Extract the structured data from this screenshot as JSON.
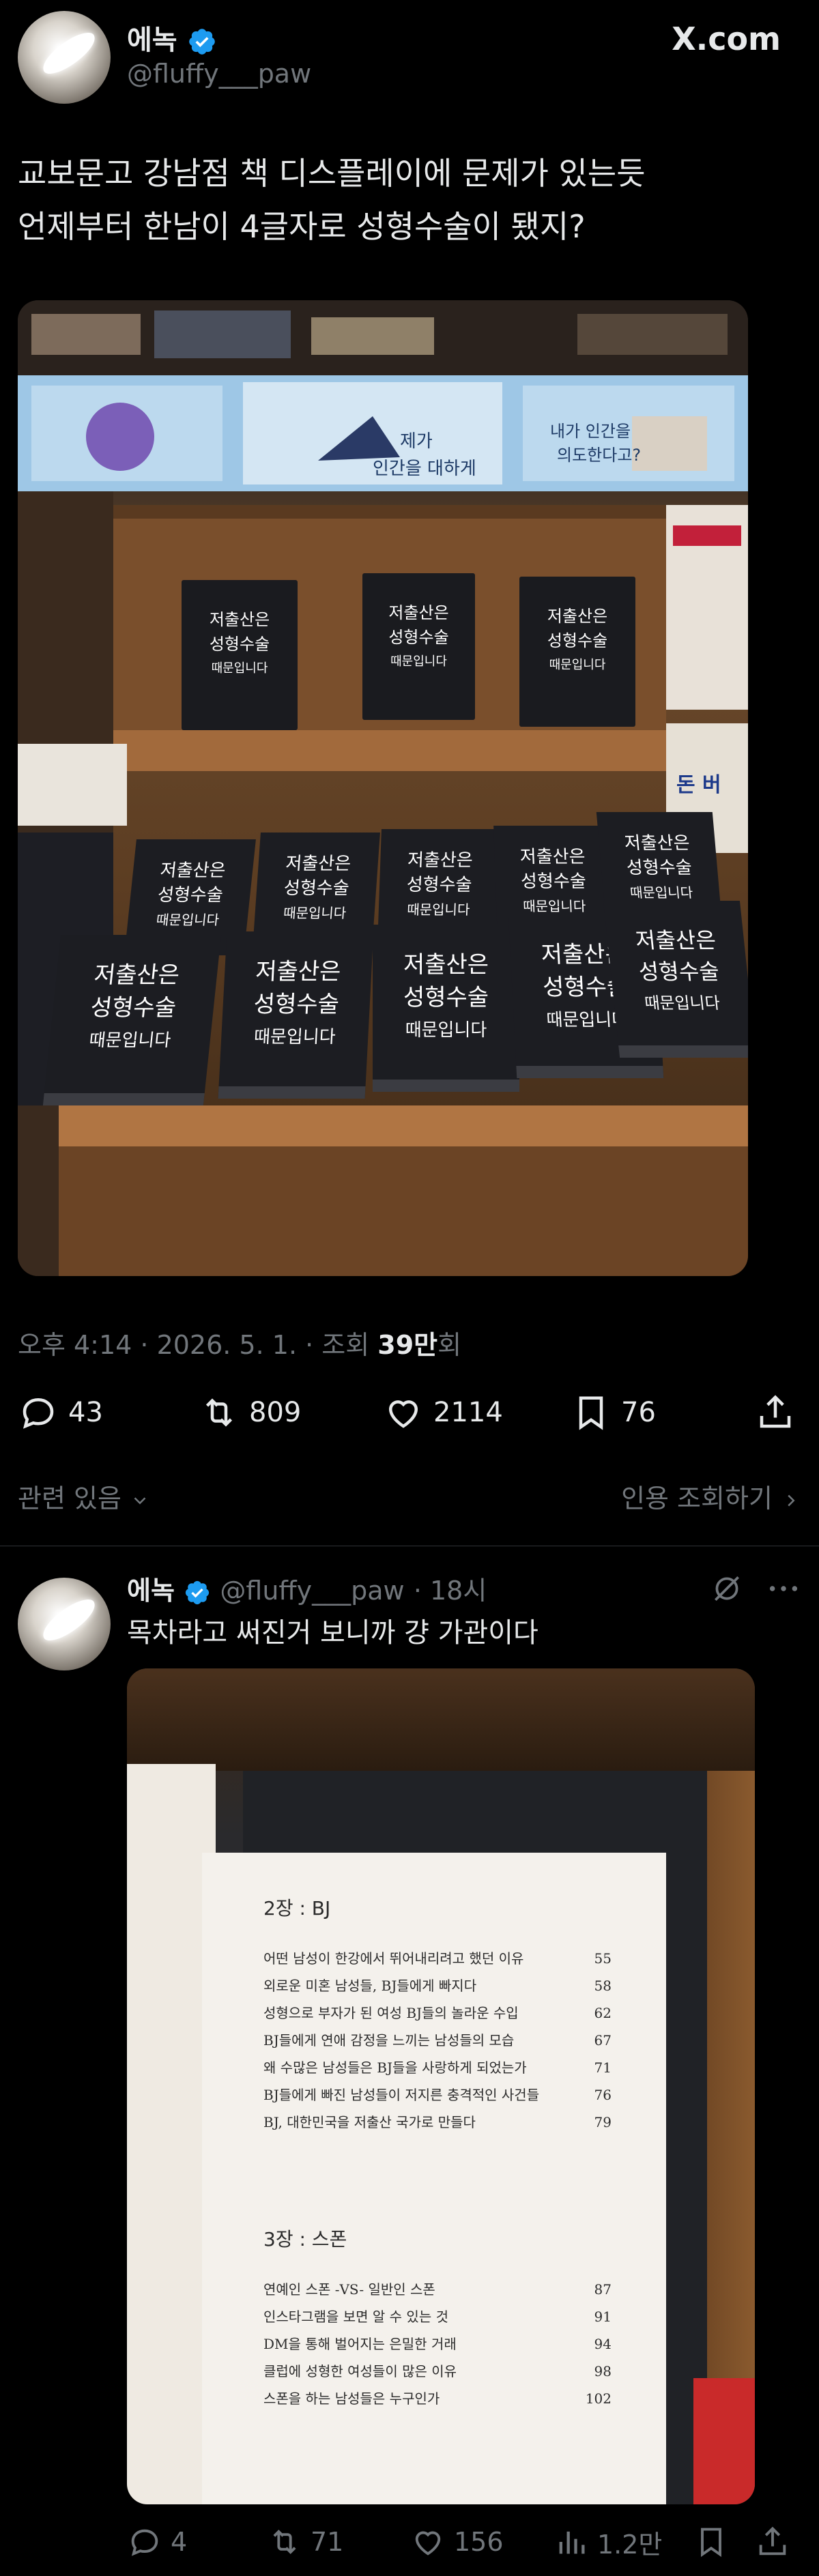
{
  "header": {
    "display_name": "에녹",
    "handle": "@fluffy___paw",
    "site_logo": "X.com"
  },
  "tweet": {
    "text_line1": "교보문고 강남점 책 디스플레이에 문제가 있는듯",
    "text_line2": "언제부터 한남이 4글자로 성형수술이 됐지?",
    "time_prefix": "오후 4:14 · 2026. 5. 1. · 조회 ",
    "views": "39만",
    "views_suffix": "회",
    "replies": "43",
    "retweets": "809",
    "likes": "2114",
    "bookmarks": "76",
    "related_label": "관련 있음",
    "quotes_label": "인용 조회하기"
  },
  "book": {
    "title_line1": "저출산은",
    "title_line2": "성형수술",
    "title_line3": "때문입니다"
  },
  "toc": {
    "chapter2": "2장 : BJ",
    "chapter2_items": [
      {
        "title": "어떤 남성이 한강에서 뛰어내리려고 했던 이유",
        "page": "55"
      },
      {
        "title": "외로운 미혼 남성들, BJ들에게 빠지다",
        "page": "58"
      },
      {
        "title": "성형으로 부자가 된 여성 BJ들의 놀라운 수입",
        "page": "62"
      },
      {
        "title": "BJ들에게 연애 감정을 느끼는 남성들의 모습",
        "page": "67"
      },
      {
        "title": "왜 수많은 남성들은 BJ들을 사랑하게 되었는가",
        "page": "71"
      },
      {
        "title": "BJ들에게 빠진 남성들이 저지른 충격적인 사건들",
        "page": "76"
      },
      {
        "title": "BJ, 대한민국을 저출산 국가로 만들다",
        "page": "79"
      }
    ],
    "chapter3": "3장 : 스폰",
    "chapter3_items": [
      {
        "title": "연예인 스폰 -VS- 일반인 스폰",
        "page": "87"
      },
      {
        "title": "인스타그램을 보면 알 수 있는 것",
        "page": "91"
      },
      {
        "title": "DM을 통해 벌어지는 은밀한 거래",
        "page": "94"
      },
      {
        "title": "클럽에 성형한 여성들이 많은 이유",
        "page": "98"
      },
      {
        "title": "스폰을 하는 남성들은 누구인가",
        "page": "102"
      }
    ]
  },
  "reply": {
    "display_name": "에녹",
    "handle": "@fluffy___paw",
    "time": "· 18시",
    "text": "목차라고 써진거 보니까 걍 가관이다",
    "replies": "4",
    "retweets": "71",
    "likes": "156",
    "views": "1.2만"
  },
  "icons": [
    "verified-badge-icon",
    "reply-icon",
    "retweet-icon",
    "like-icon",
    "bookmark-icon",
    "share-icon",
    "chevron-down-icon",
    "chevron-right-icon",
    "grok-icon",
    "more-icon",
    "views-icon"
  ],
  "colors": {
    "background": "#000000",
    "text": "#e7e9ea",
    "secondary": "#71767b",
    "verified": "#1d9bf0"
  }
}
